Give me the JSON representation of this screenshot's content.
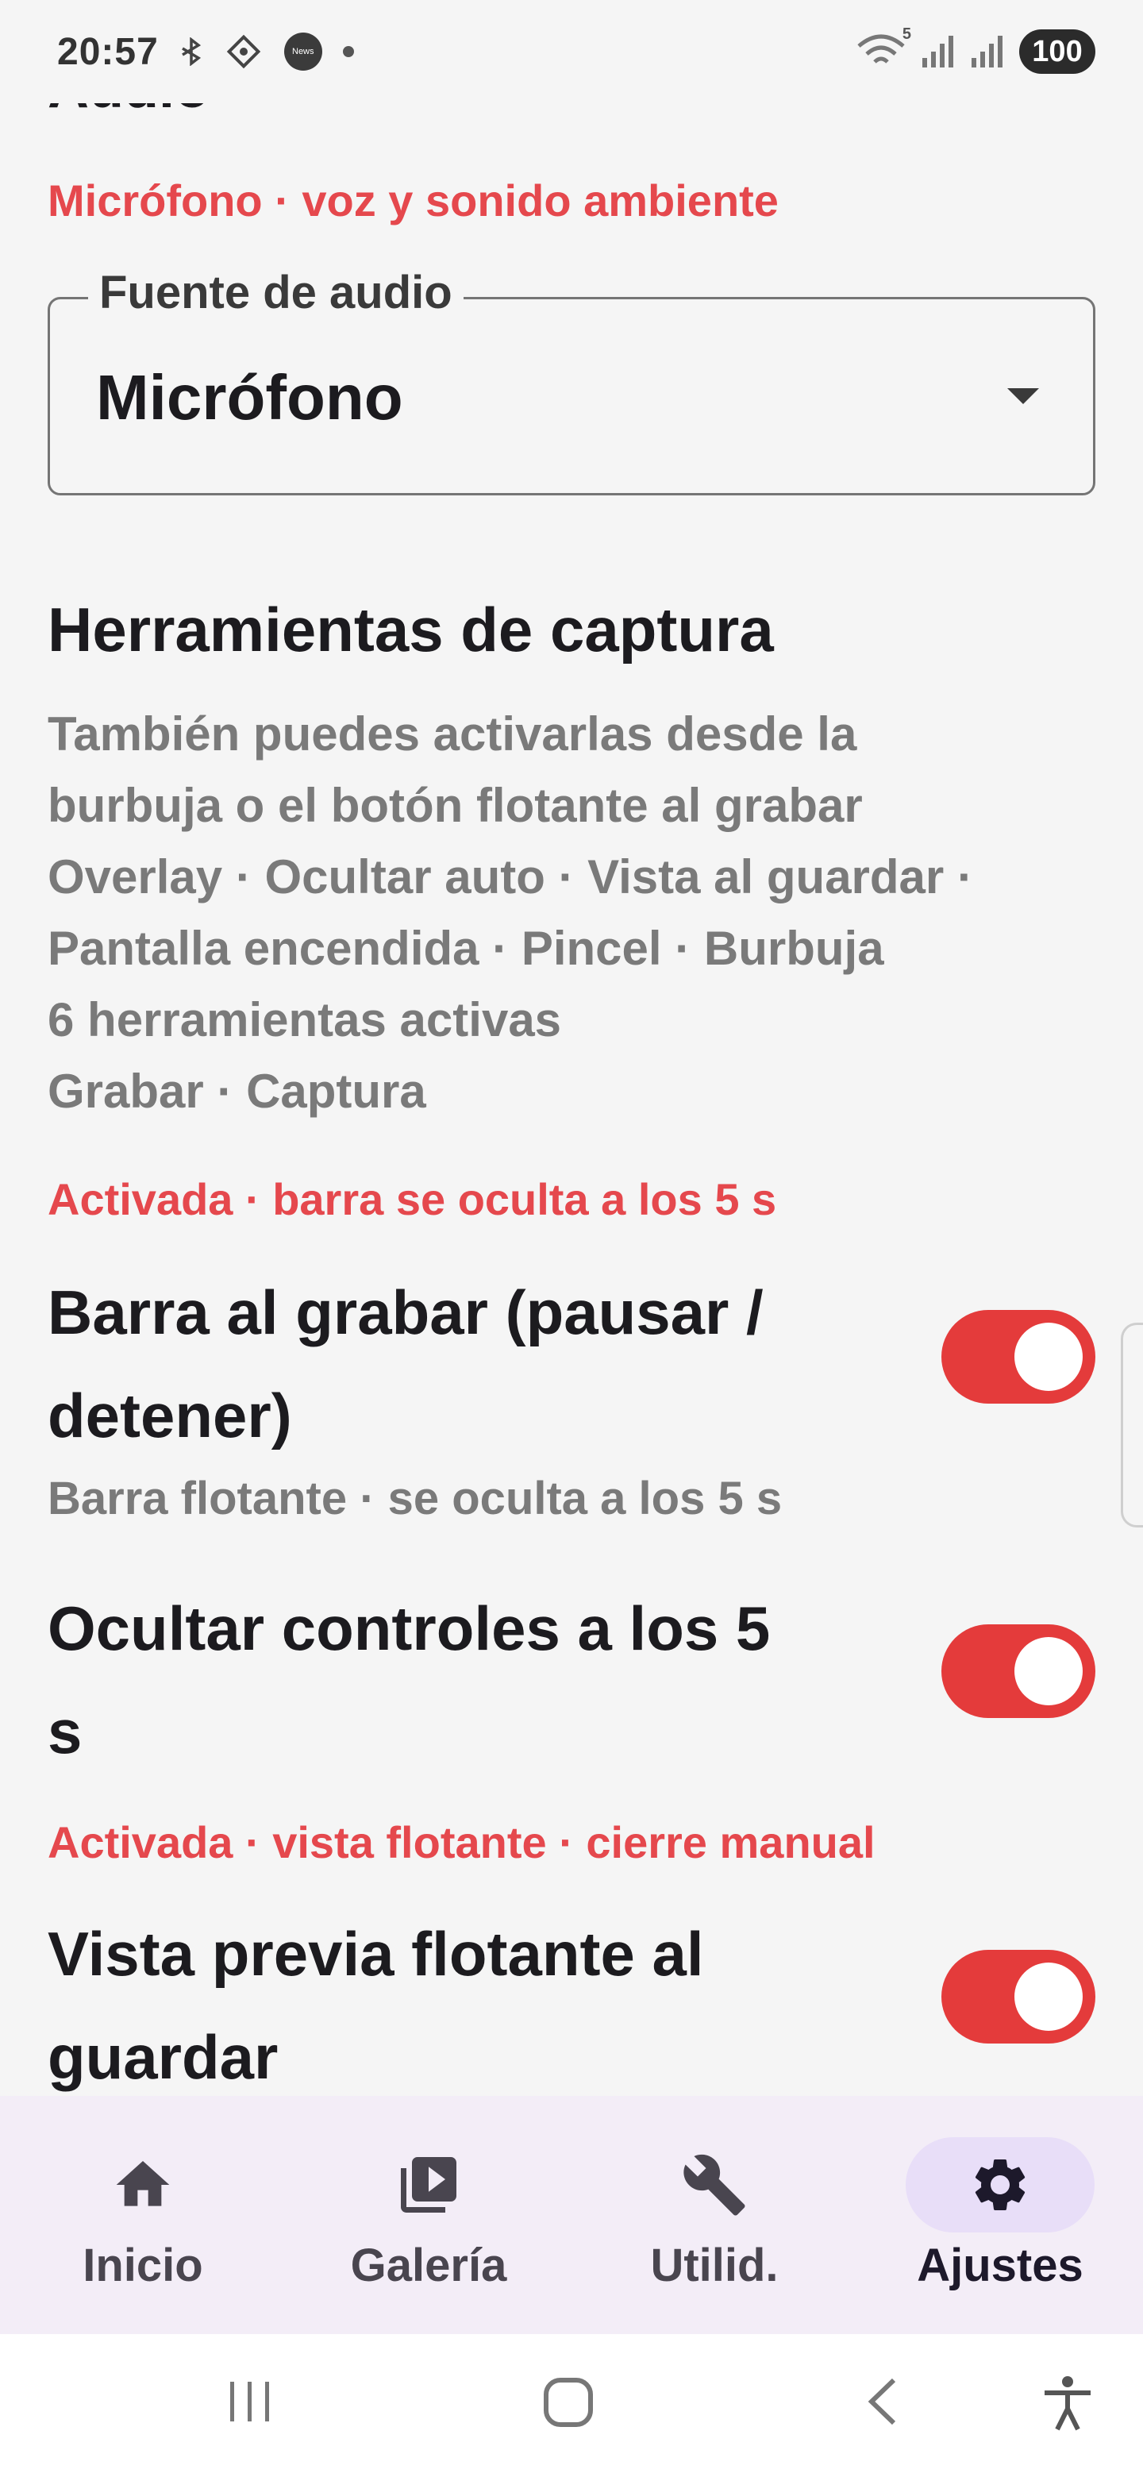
{
  "status_bar": {
    "time": "20:57",
    "news_label": "News",
    "network_label": "5",
    "battery": "100"
  },
  "audio": {
    "section_title": "Audio",
    "subtitle": "Micrófono · voz y sonido ambiente",
    "field_label": "Fuente de audio",
    "field_value": "Micrófono"
  },
  "tools": {
    "title": "Herramientas de captura",
    "desc_lines": [
      "También puedes activarlas desde la",
      "burbuja o el botón flotante al grabar",
      "Overlay · Ocultar auto · Vista al guardar ·",
      "Pantalla encendida · Pincel · Burbuja",
      "6 herramientas activas",
      "Grabar · Captura"
    ]
  },
  "settings": [
    {
      "status": "Activada · barra se oculta a los 5 s",
      "title_lines": [
        "Barra al grabar (pausar /",
        "detener)"
      ],
      "subtitle": "Barra flotante · se oculta a los 5 s",
      "enabled": true
    },
    {
      "status": "",
      "title_lines": [
        "Ocultar controles a los 5",
        "s"
      ],
      "subtitle": "",
      "enabled": true
    },
    {
      "status": "Activada · vista flotante · cierre manual",
      "title_lines": [
        "Vista previa flotante al",
        "guardar"
      ],
      "subtitle": "",
      "enabled": true
    }
  ],
  "nav": {
    "items": [
      {
        "label": "Inicio",
        "icon": "home-icon"
      },
      {
        "label": "Galería",
        "icon": "video-library-icon"
      },
      {
        "label": "Utilid.",
        "icon": "wrench-icon"
      },
      {
        "label": "Ajustes",
        "icon": "gear-icon",
        "active": true
      }
    ]
  },
  "colors": {
    "accent": "#e5484d",
    "switch_on": "#e43b3b",
    "nav_bg": "#f3edf7",
    "nav_active": "#e8def8"
  }
}
